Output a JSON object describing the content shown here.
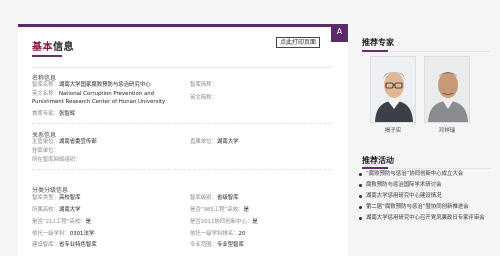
{
  "header": {
    "title_accent": "基本",
    "title_rest": "信息",
    "print_label": "点此打印页面",
    "corner_label": "A"
  },
  "name_section": {
    "title": "名称信息",
    "cn_name_label": "智库名称：",
    "cn_name_value": "湖南大学国家腐败预防与惩治研究中心",
    "abbr_label": "智库简称：",
    "en_name_label": "英文名称：",
    "en_name_value_1": "National Corruption Prevention and",
    "en_name_value_2": "Punishment Research Center of Hunan University",
    "en_abbr_label": "英文简称：",
    "head_label": "首席专家：",
    "head_value": "张智辉"
  },
  "relation_section": {
    "title": "关系信息",
    "supervisor_label": "主管单位：",
    "supervisor_value": "湖南省委宣传部",
    "direct_label": "直属单位：",
    "direct_value": "湖南大学",
    "attached_label": "挂靠单位：",
    "network_label": "所在智库网络组织："
  },
  "category_section": {
    "title": "分类分级信息",
    "type_label": "智库类型：",
    "type_value": "高校智库",
    "level_label": "智库级别：",
    "level_value": "省级智库",
    "province_label": "所属高校：",
    "province_value": "湖南大学",
    "is985_label": "是否“985工程”高校：",
    "is985_value": "是",
    "is211_label": "是否“211工程”高校：",
    "is211_value": "是",
    "is2011_label": "是否2011协同创新中心：",
    "is2011_value": "是",
    "discipline1_label": "依托一级学科：",
    "discipline1_value": "0301法学",
    "discipline2_label": "依托一级学科排名：",
    "discipline2_value": "20",
    "build_label": "建设智库：",
    "build_value": "省专业特色智库",
    "domain_label": "专业范围：",
    "domain_value": "专业型智库"
  },
  "experts": {
    "title": "推荐专家",
    "items": [
      {
        "name": "揭子实",
        "photo_icon": "person-photo-young"
      },
      {
        "name": "邓祥瑞",
        "photo_icon": "person-photo-older"
      }
    ]
  },
  "activities": {
    "title": "推荐活动",
    "items": [
      "“腐败预防与惩治”协同创新中心成立大会",
      "腐败预防与惩治国际学术研讨会",
      "湖南大学惩用研究中心建设情况",
      "第二届“腐败预防与惩治”暨协同创新推进会",
      "湖南大学惩用研究中心召开党风廉政日专家评审会"
    ]
  },
  "colors": {
    "brand_purple": "#5a2a6b",
    "accent_red": "#8a1e3c"
  }
}
